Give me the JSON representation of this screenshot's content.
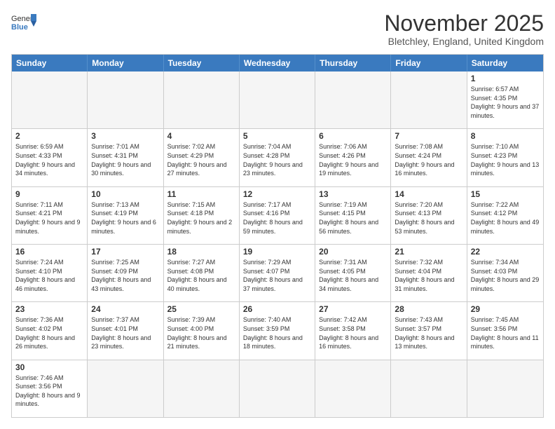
{
  "header": {
    "logo_general": "General",
    "logo_blue": "Blue",
    "month_title": "November 2025",
    "location": "Bletchley, England, United Kingdom"
  },
  "days_of_week": [
    "Sunday",
    "Monday",
    "Tuesday",
    "Wednesday",
    "Thursday",
    "Friday",
    "Saturday"
  ],
  "weeks": [
    [
      {
        "day": "",
        "info": "",
        "empty": true
      },
      {
        "day": "",
        "info": "",
        "empty": true
      },
      {
        "day": "",
        "info": "",
        "empty": true
      },
      {
        "day": "",
        "info": "",
        "empty": true
      },
      {
        "day": "",
        "info": "",
        "empty": true
      },
      {
        "day": "",
        "info": "",
        "empty": true
      },
      {
        "day": "1",
        "info": "Sunrise: 6:57 AM\nSunset: 4:35 PM\nDaylight: 9 hours\nand 37 minutes.",
        "empty": false
      }
    ],
    [
      {
        "day": "2",
        "info": "Sunrise: 6:59 AM\nSunset: 4:33 PM\nDaylight: 9 hours\nand 34 minutes.",
        "empty": false
      },
      {
        "day": "3",
        "info": "Sunrise: 7:01 AM\nSunset: 4:31 PM\nDaylight: 9 hours\nand 30 minutes.",
        "empty": false
      },
      {
        "day": "4",
        "info": "Sunrise: 7:02 AM\nSunset: 4:29 PM\nDaylight: 9 hours\nand 27 minutes.",
        "empty": false
      },
      {
        "day": "5",
        "info": "Sunrise: 7:04 AM\nSunset: 4:28 PM\nDaylight: 9 hours\nand 23 minutes.",
        "empty": false
      },
      {
        "day": "6",
        "info": "Sunrise: 7:06 AM\nSunset: 4:26 PM\nDaylight: 9 hours\nand 19 minutes.",
        "empty": false
      },
      {
        "day": "7",
        "info": "Sunrise: 7:08 AM\nSunset: 4:24 PM\nDaylight: 9 hours\nand 16 minutes.",
        "empty": false
      },
      {
        "day": "8",
        "info": "Sunrise: 7:10 AM\nSunset: 4:23 PM\nDaylight: 9 hours\nand 13 minutes.",
        "empty": false
      }
    ],
    [
      {
        "day": "9",
        "info": "Sunrise: 7:11 AM\nSunset: 4:21 PM\nDaylight: 9 hours\nand 9 minutes.",
        "empty": false
      },
      {
        "day": "10",
        "info": "Sunrise: 7:13 AM\nSunset: 4:19 PM\nDaylight: 9 hours\nand 6 minutes.",
        "empty": false
      },
      {
        "day": "11",
        "info": "Sunrise: 7:15 AM\nSunset: 4:18 PM\nDaylight: 9 hours\nand 2 minutes.",
        "empty": false
      },
      {
        "day": "12",
        "info": "Sunrise: 7:17 AM\nSunset: 4:16 PM\nDaylight: 8 hours\nand 59 minutes.",
        "empty": false
      },
      {
        "day": "13",
        "info": "Sunrise: 7:19 AM\nSunset: 4:15 PM\nDaylight: 8 hours\nand 56 minutes.",
        "empty": false
      },
      {
        "day": "14",
        "info": "Sunrise: 7:20 AM\nSunset: 4:13 PM\nDaylight: 8 hours\nand 53 minutes.",
        "empty": false
      },
      {
        "day": "15",
        "info": "Sunrise: 7:22 AM\nSunset: 4:12 PM\nDaylight: 8 hours\nand 49 minutes.",
        "empty": false
      }
    ],
    [
      {
        "day": "16",
        "info": "Sunrise: 7:24 AM\nSunset: 4:10 PM\nDaylight: 8 hours\nand 46 minutes.",
        "empty": false
      },
      {
        "day": "17",
        "info": "Sunrise: 7:25 AM\nSunset: 4:09 PM\nDaylight: 8 hours\nand 43 minutes.",
        "empty": false
      },
      {
        "day": "18",
        "info": "Sunrise: 7:27 AM\nSunset: 4:08 PM\nDaylight: 8 hours\nand 40 minutes.",
        "empty": false
      },
      {
        "day": "19",
        "info": "Sunrise: 7:29 AM\nSunset: 4:07 PM\nDaylight: 8 hours\nand 37 minutes.",
        "empty": false
      },
      {
        "day": "20",
        "info": "Sunrise: 7:31 AM\nSunset: 4:05 PM\nDaylight: 8 hours\nand 34 minutes.",
        "empty": false
      },
      {
        "day": "21",
        "info": "Sunrise: 7:32 AM\nSunset: 4:04 PM\nDaylight: 8 hours\nand 31 minutes.",
        "empty": false
      },
      {
        "day": "22",
        "info": "Sunrise: 7:34 AM\nSunset: 4:03 PM\nDaylight: 8 hours\nand 29 minutes.",
        "empty": false
      }
    ],
    [
      {
        "day": "23",
        "info": "Sunrise: 7:36 AM\nSunset: 4:02 PM\nDaylight: 8 hours\nand 26 minutes.",
        "empty": false
      },
      {
        "day": "24",
        "info": "Sunrise: 7:37 AM\nSunset: 4:01 PM\nDaylight: 8 hours\nand 23 minutes.",
        "empty": false
      },
      {
        "day": "25",
        "info": "Sunrise: 7:39 AM\nSunset: 4:00 PM\nDaylight: 8 hours\nand 21 minutes.",
        "empty": false
      },
      {
        "day": "26",
        "info": "Sunrise: 7:40 AM\nSunset: 3:59 PM\nDaylight: 8 hours\nand 18 minutes.",
        "empty": false
      },
      {
        "day": "27",
        "info": "Sunrise: 7:42 AM\nSunset: 3:58 PM\nDaylight: 8 hours\nand 16 minutes.",
        "empty": false
      },
      {
        "day": "28",
        "info": "Sunrise: 7:43 AM\nSunset: 3:57 PM\nDaylight: 8 hours\nand 13 minutes.",
        "empty": false
      },
      {
        "day": "29",
        "info": "Sunrise: 7:45 AM\nSunset: 3:56 PM\nDaylight: 8 hours\nand 11 minutes.",
        "empty": false
      }
    ],
    [
      {
        "day": "30",
        "info": "Sunrise: 7:46 AM\nSunset: 3:56 PM\nDaylight: 8 hours\nand 9 minutes.",
        "empty": false
      },
      {
        "day": "",
        "info": "",
        "empty": true
      },
      {
        "day": "",
        "info": "",
        "empty": true
      },
      {
        "day": "",
        "info": "",
        "empty": true
      },
      {
        "day": "",
        "info": "",
        "empty": true
      },
      {
        "day": "",
        "info": "",
        "empty": true
      },
      {
        "day": "",
        "info": "",
        "empty": true
      }
    ]
  ]
}
